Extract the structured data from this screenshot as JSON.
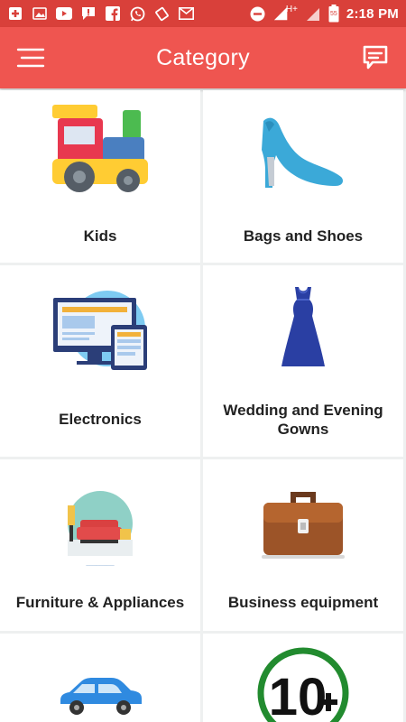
{
  "status_bar": {
    "time": "2:18 PM",
    "battery": "55",
    "network": "H+"
  },
  "app_bar": {
    "title": "Category"
  },
  "categories": [
    {
      "label": "Kids"
    },
    {
      "label": "Bags and Shoes"
    },
    {
      "label": "Electronics"
    },
    {
      "label": "Wedding and Evening Gowns"
    },
    {
      "label": "Furniture & Appliances"
    },
    {
      "label": "Business equipment"
    },
    {
      "label": ""
    },
    {
      "label": ""
    }
  ],
  "colors": {
    "status_bar": "#d9403a",
    "app_bar": "#ef5550"
  }
}
